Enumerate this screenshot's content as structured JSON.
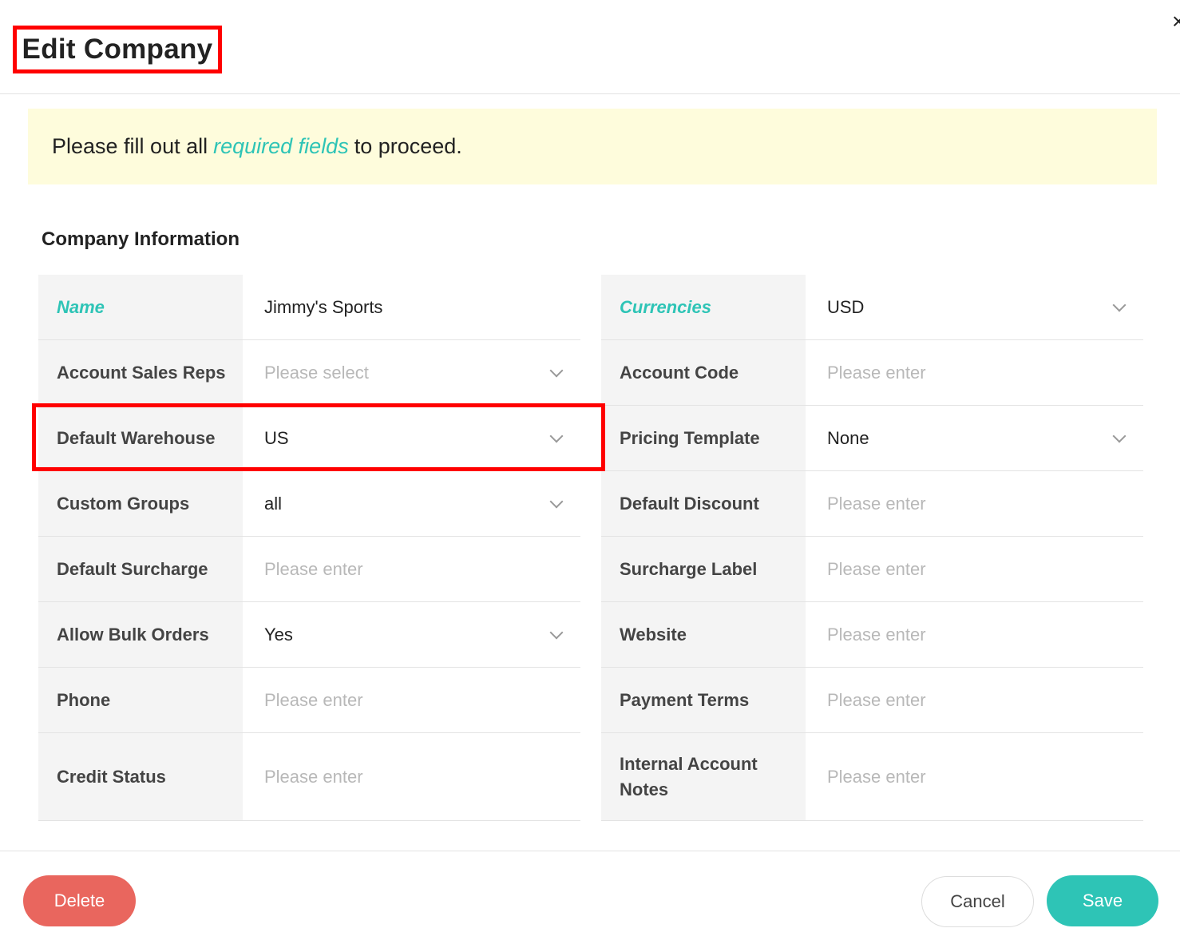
{
  "header": {
    "title": "Edit Company",
    "close_icon": "×"
  },
  "notice": {
    "prefix": "Please fill out all",
    "link": "required fields",
    "suffix": "to proceed."
  },
  "section": {
    "title": "Company Information"
  },
  "form": {
    "left": [
      {
        "label": "Name",
        "value": "Jimmy's Sports"
      },
      {
        "label": "Account Sales Reps",
        "placeholder": "Please select"
      },
      {
        "label": "Default Warehouse",
        "value": "US"
      },
      {
        "label": "Custom Groups",
        "value": "all"
      },
      {
        "label": "Default Surcharge",
        "placeholder": "Please enter"
      },
      {
        "label": "Allow Bulk Orders",
        "value": "Yes"
      },
      {
        "label": "Phone",
        "placeholder": "Please enter"
      },
      {
        "label": "Credit Status",
        "placeholder": "Please enter"
      }
    ],
    "right": [
      {
        "label": "Currencies",
        "value": "USD"
      },
      {
        "label": "Account Code",
        "placeholder": "Please enter"
      },
      {
        "label": "Pricing Template",
        "value": "None"
      },
      {
        "label": "Default Discount",
        "placeholder": "Please enter"
      },
      {
        "label": "Surcharge Label",
        "placeholder": "Please enter"
      },
      {
        "label": "Website",
        "placeholder": "Please enter"
      },
      {
        "label": "Payment Terms",
        "placeholder": "Please enter"
      },
      {
        "label": "Internal Account Notes",
        "placeholder": "Please enter"
      }
    ]
  },
  "footer": {
    "delete_label": "Delete",
    "cancel_label": "Cancel",
    "save_label": "Save"
  },
  "colors": {
    "accent": "#2ec4b6",
    "danger": "#e9665e",
    "notice_bg": "#fefcdc",
    "highlight": "#ff0000"
  }
}
